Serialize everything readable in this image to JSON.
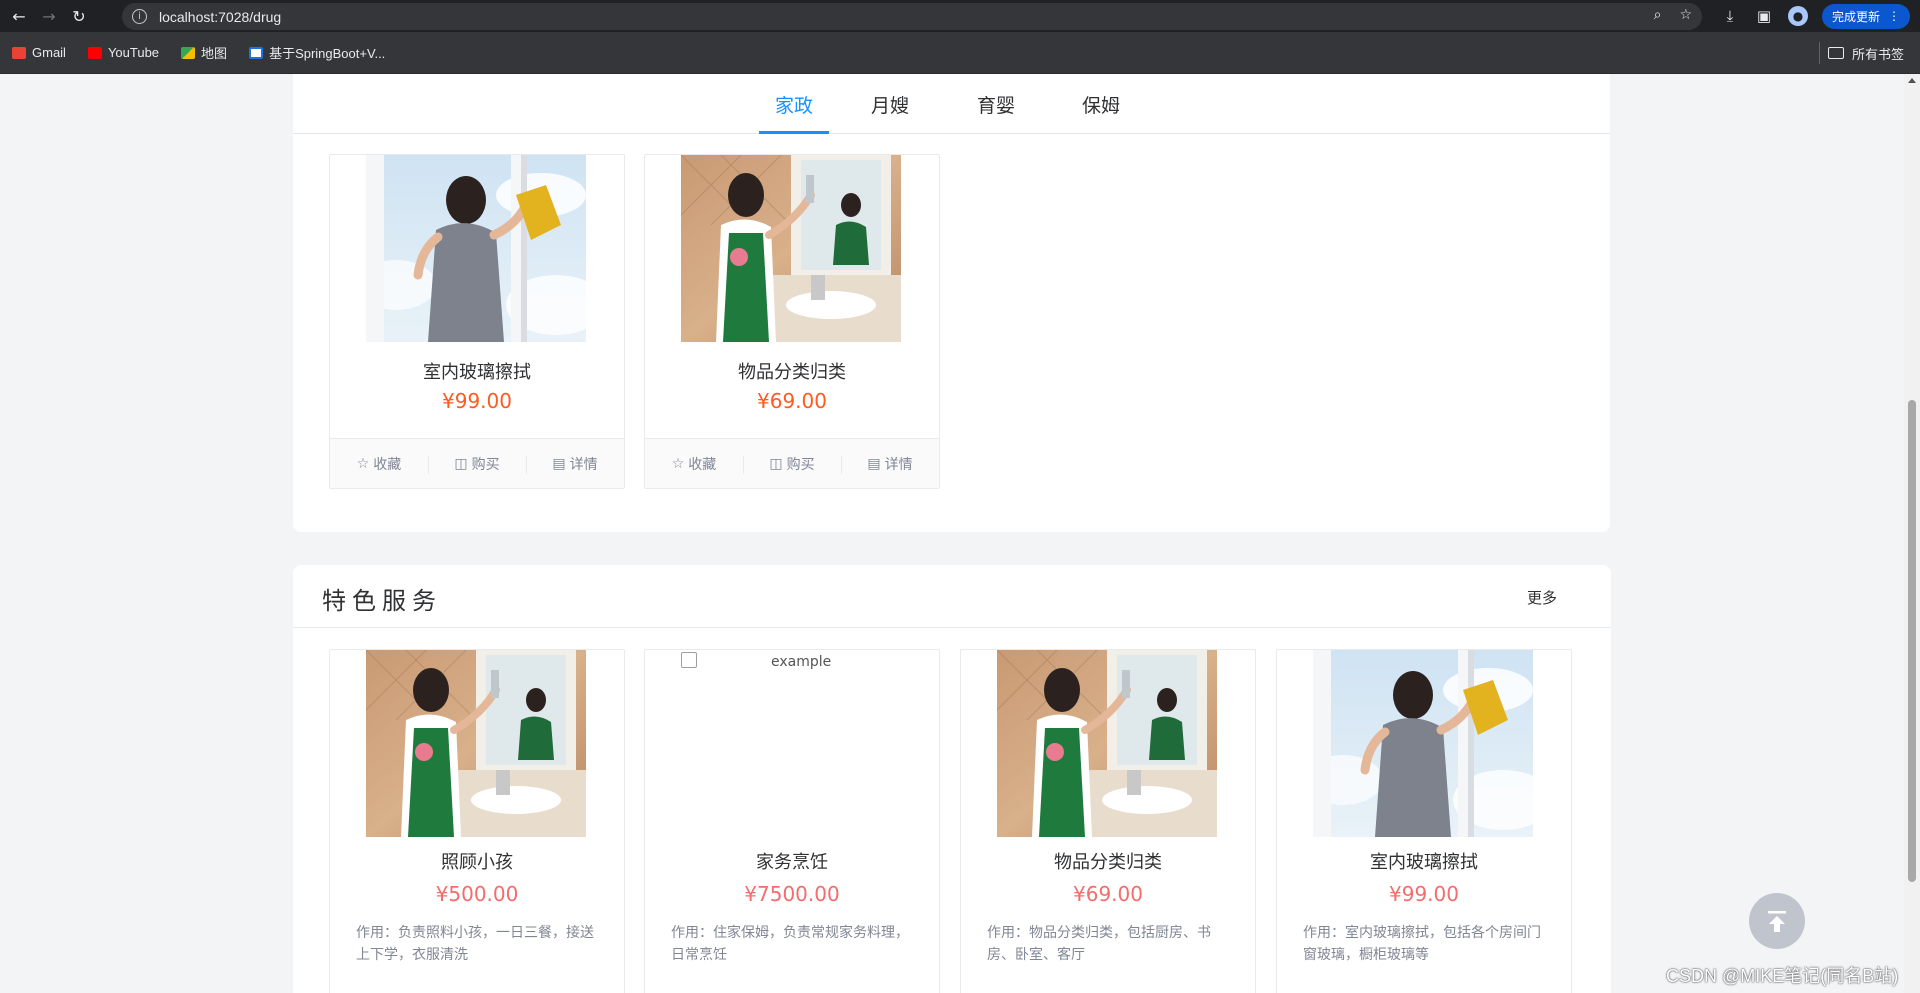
{
  "browser": {
    "url": "localhost:7028/drug",
    "update_label": "完成更新",
    "bookmarks": [
      {
        "label": "Gmail",
        "color": "#ea4335"
      },
      {
        "label": "YouTube",
        "color": "#ff0000"
      },
      {
        "label": "地图",
        "color": "#34a853"
      },
      {
        "label": "基于SpringBoot+V...",
        "color": "#1a73e8"
      }
    ],
    "bookmarks_folder": "所有书签"
  },
  "tabs": [
    {
      "label": "家政",
      "active": true
    },
    {
      "label": "月嫂",
      "active": false
    },
    {
      "label": "育婴",
      "active": false
    },
    {
      "label": "保姆",
      "active": false
    }
  ],
  "top_cards": [
    {
      "title": "室内玻璃擦拭",
      "price": "¥99.00",
      "image": "window-cleaning"
    },
    {
      "title": "物品分类归类",
      "price": "¥69.00",
      "image": "bathroom-mirror-cleaning"
    }
  ],
  "card_actions": [
    {
      "label": "收藏",
      "icon": "star-icon"
    },
    {
      "label": "购买",
      "icon": "bag-icon"
    },
    {
      "label": "详情",
      "icon": "details-icon"
    }
  ],
  "featured": {
    "title": "特色服务",
    "more_label": "更多",
    "cards": [
      {
        "title": "照顾小孩",
        "price": "¥500.00",
        "desc": "作用：负责照料小孩，一日三餐，接送上下学，衣服清洗",
        "image": "bathroom-mirror-cleaning"
      },
      {
        "title": "家务烹饪",
        "price": "¥7500.00",
        "desc": "作用：住家保姆，负责常规家务料理，日常烹饪",
        "image": "broken",
        "alt": "example"
      },
      {
        "title": "物品分类归类",
        "price": "¥69.00",
        "desc": "作用：物品分类归类，包括厨房、书房、卧室、客厅",
        "image": "bathroom-mirror-cleaning"
      },
      {
        "title": "室内玻璃擦拭",
        "price": "¥99.00",
        "desc": "作用：室内玻璃擦拭，包括各个房间门窗玻璃，橱柜玻璃等",
        "image": "window-cleaning"
      }
    ]
  },
  "watermark": "CSDN @MIKE笔记(同名B站)"
}
